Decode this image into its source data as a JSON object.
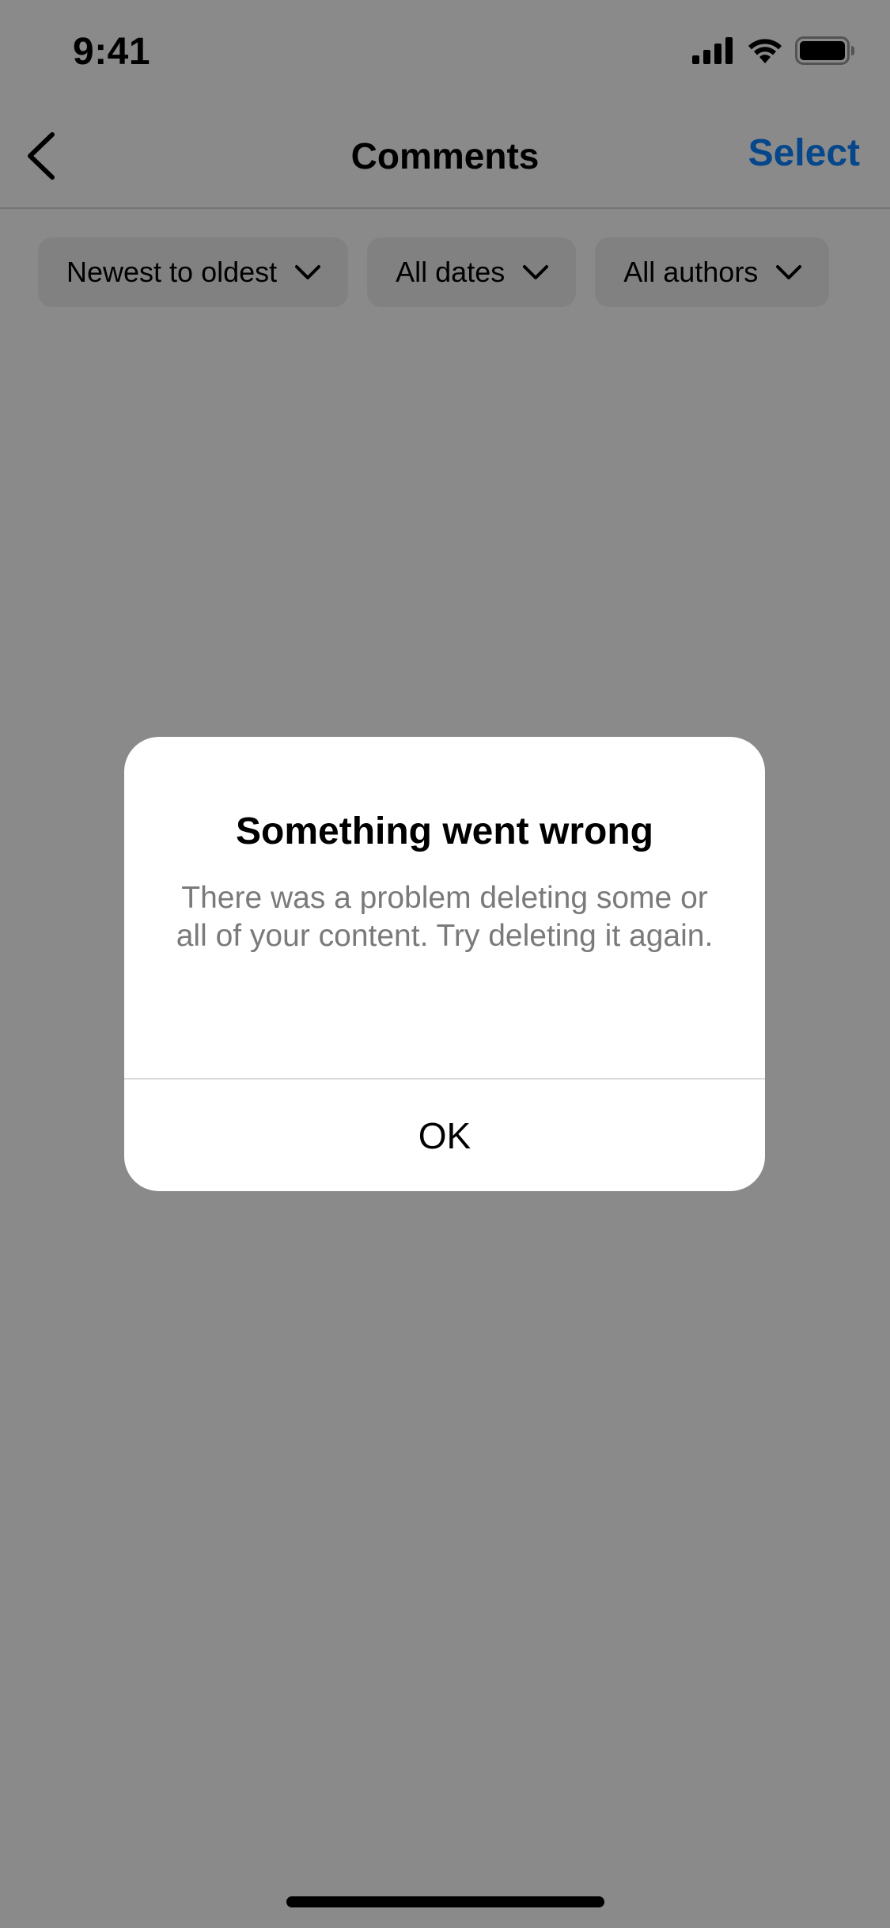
{
  "status_bar": {
    "time": "9:41",
    "icons": [
      "cellular-signal-icon",
      "wifi-icon",
      "battery-icon"
    ]
  },
  "nav": {
    "back_icon": "chevron-left-icon",
    "title": "Comments",
    "select_label": "Select"
  },
  "filters": [
    {
      "label": "Newest to oldest",
      "icon": "chevron-down-icon"
    },
    {
      "label": "All dates",
      "icon": "chevron-down-icon"
    },
    {
      "label": "All authors",
      "icon": "chevron-down-icon"
    }
  ],
  "alert": {
    "title": "Something went wrong",
    "message": "There was a problem deleting some or all of your content. Try deleting it again.",
    "ok_label": "OK"
  },
  "colors": {
    "accent": "#0a84ff",
    "chip_bg": "#efefef",
    "overlay": "rgba(0,0,0,0.46)",
    "alert_message": "#7a7a7a"
  }
}
